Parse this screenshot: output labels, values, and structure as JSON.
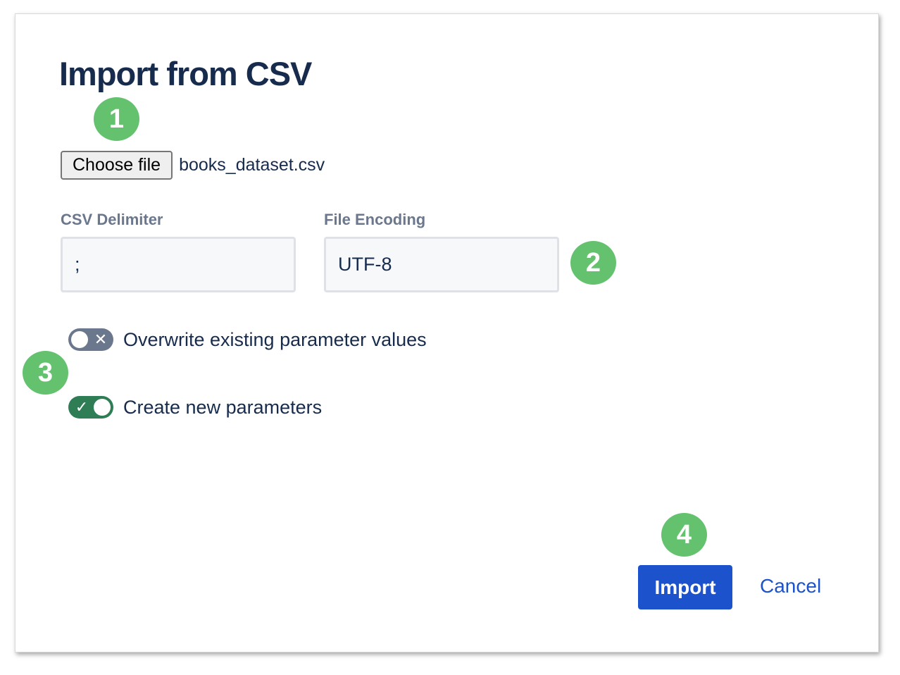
{
  "dialog": {
    "title": "Import from CSV"
  },
  "file": {
    "choose_label": "Choose file",
    "file_name": "books_dataset.csv"
  },
  "fields": {
    "delimiter": {
      "label": "CSV Delimiter",
      "value": ";"
    },
    "encoding": {
      "label": "File Encoding",
      "value": "UTF-8"
    }
  },
  "toggles": {
    "overwrite": {
      "label": "Overwrite existing parameter values",
      "checked": false,
      "icon": "close-icon"
    },
    "create_new": {
      "label": "Create new parameters",
      "checked": true,
      "icon": "check-icon"
    }
  },
  "actions": {
    "import_label": "Import",
    "cancel_label": "Cancel"
  },
  "callouts": {
    "step1": "1",
    "step2": "2",
    "step3": "3",
    "step4": "4",
    "color": "#64c26f"
  },
  "colors": {
    "primary": "#1c52cc",
    "title": "#172b4d",
    "label": "#6b778c",
    "toggle_on": "#2f7d55",
    "toggle_off": "#6b778c"
  }
}
